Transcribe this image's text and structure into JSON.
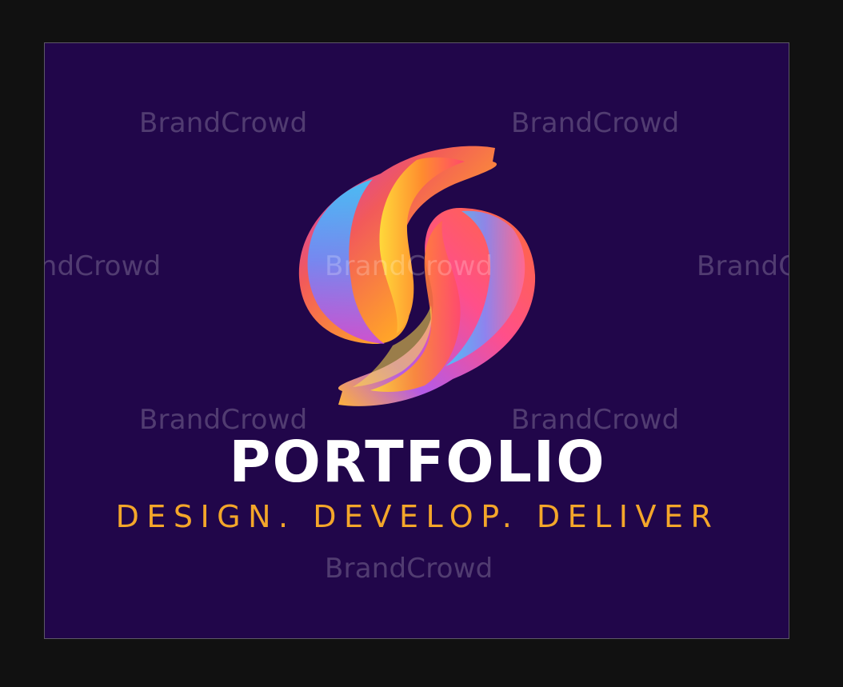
{
  "logo": {
    "title": "PORTFOLIO",
    "tagline": "DESIGN. DEVELOP. DELIVER",
    "mark_icon": "colorful-swirl-s-icon"
  },
  "watermark": {
    "text": "BrandCrowd"
  },
  "colors": {
    "outer_background": "#111111",
    "canvas_background": "#21064a",
    "title": "#ffffff",
    "tagline": "#f4a62a"
  }
}
